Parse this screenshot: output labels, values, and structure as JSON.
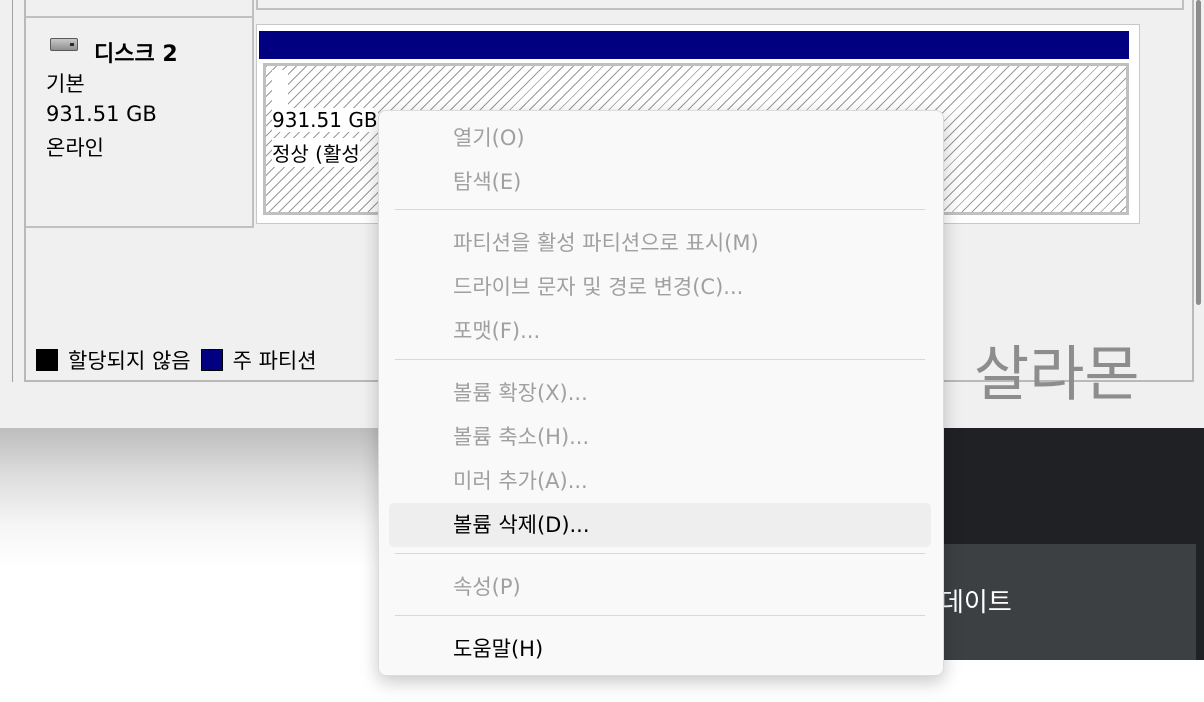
{
  "disk": {
    "name": "디스크 2",
    "type": "기본",
    "size": "931.51 GB",
    "status": "온라인"
  },
  "partition": {
    "size_text": "931.51 GB",
    "status_text": "정상 (활성"
  },
  "legend": {
    "unallocated": "할당되지 않음",
    "primary": "주 파티션",
    "unallocated_color": "#000000",
    "primary_color": "#000080"
  },
  "watermark": "살라몬",
  "background_app": {
    "text": "데이트"
  },
  "context_menu": {
    "items": [
      {
        "label": "열기(O)",
        "enabled": false
      },
      {
        "label": "탐색(E)",
        "enabled": false
      },
      {
        "label": "파티션을 활성 파티션으로 표시(M)",
        "enabled": false
      },
      {
        "label": "드라이브 문자 및 경로 변경(C)...",
        "enabled": false
      },
      {
        "label": "포맷(F)...",
        "enabled": false
      },
      {
        "label": "볼륨 확장(X)...",
        "enabled": false
      },
      {
        "label": "볼륨 축소(H)...",
        "enabled": false
      },
      {
        "label": "미러 추가(A)...",
        "enabled": false
      },
      {
        "label": "볼륨 삭제(D)...",
        "enabled": true,
        "highlighted": true
      },
      {
        "label": "속성(P)",
        "enabled": false
      },
      {
        "label": "도움말(H)",
        "enabled": true
      }
    ]
  },
  "colors": {
    "partition_header": "#000080",
    "disabled_text": "#a0a0a0",
    "enabled_text": "#000000"
  }
}
